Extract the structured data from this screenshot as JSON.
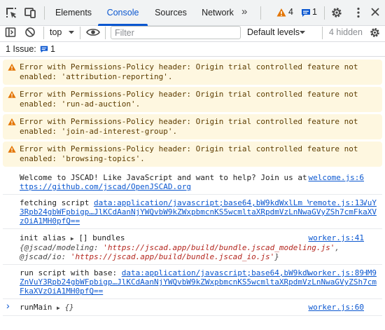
{
  "tabs": [
    {
      "label": "Elements"
    },
    {
      "label": "Console"
    },
    {
      "label": "Sources"
    },
    {
      "label": "Network"
    }
  ],
  "more_tabs": "»",
  "warning_count": "4",
  "issue_count": "1",
  "toolbar": {
    "context": "top",
    "filter_placeholder": "Filter",
    "levels": "Default levels",
    "hidden": "4 hidden"
  },
  "issues_bar": {
    "label": "1 Issue:",
    "count": "1"
  },
  "warnings": [
    {
      "text": "Error with Permissions-Policy header: Origin trial controlled feature not enabled: 'attribution-reporting'."
    },
    {
      "text": "Error with Permissions-Policy header: Origin trial controlled feature not enabled: 'run-ad-auction'."
    },
    {
      "text": "Error with Permissions-Policy header: Origin trial controlled feature not enabled: 'join-ad-interest-group'."
    },
    {
      "text": "Error with Permissions-Policy header: Origin trial controlled feature not enabled: 'browsing-topics'."
    }
  ],
  "logs": {
    "welcome": {
      "text": "Welcome to JSCAD! Like JavaScript and want to help? Join us at ",
      "link": "https://github.com/jscad/OpenJSCAD.org",
      "source": "welcome.js:6"
    },
    "fetching": {
      "text": "fetching script ",
      "link": "data:application/javascript;base64,bW9kdWxlLm V4cG9ydHM9ZnVuY3Rpb24gbWFpbigp…JlKCdAanNjYWQvbW9kZWxpbmcnKS5wcmltaXRpdmVzLnNwaGVyZSh7cmFkaXVzOiA1MH0pfQ==",
      "source": "remote.js:13"
    },
    "init": {
      "text": "init alias ",
      "obj": "[] bundles",
      "k1": "{@jscad/modeling: ",
      "v1": "'https://jscad.app/build/bundle.jscad_modeling.js'",
      "k2": ", @jscad/io: ",
      "v2": "'https://jscad.app/build/bundle.jscad_io.js'",
      "end": "}",
      "source": "worker.js:41"
    },
    "run": {
      "text": "run script with base: ",
      "link": "data:application/javascript;base64,bW9kdWxlLmV4cG9ydHM9ZnVuY3Rpb24gbWFpbigp…JlKCdAanNjYWQvbW9kZWxpbmcnKS5wcmltaXRpdmVzLnNwaGVyZSh7cmFkaXVzOiA1MH0pfQ==",
      "source": "worker.js:89"
    },
    "runmain": {
      "text": "runMain ",
      "obj": "{}",
      "source": "worker.js:60"
    }
  },
  "prompt": "›",
  "colors": {
    "accent": "#0b57d0",
    "warning_bg": "#fef7e0",
    "warning_icon": "#e37400"
  }
}
